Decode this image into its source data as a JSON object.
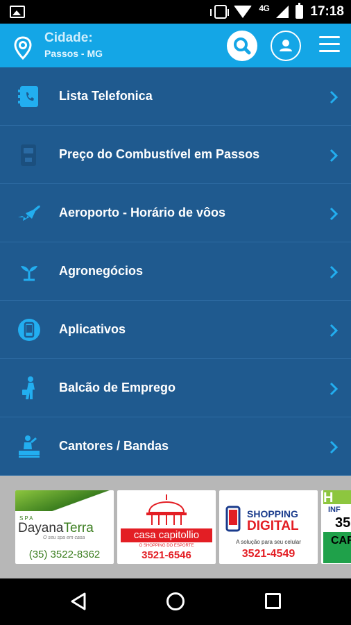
{
  "status_bar": {
    "network": "4G",
    "time": "17:18"
  },
  "header": {
    "city_label": "Cidade:",
    "city_value": "Passos - MG"
  },
  "menu": {
    "items": [
      {
        "label": "Lista Telefonica",
        "icon": "phonebook-icon"
      },
      {
        "label": "Preço do Combustível em Passos",
        "icon": "fuel-pump-icon"
      },
      {
        "label": "Aeroporto - Horário de vôos",
        "icon": "airplane-icon"
      },
      {
        "label": "Agronegócios",
        "icon": "sprout-icon"
      },
      {
        "label": "Aplicativos",
        "icon": "mobile-app-icon"
      },
      {
        "label": "Balcão de Emprego",
        "icon": "job-seeker-icon"
      },
      {
        "label": "Cantores / Bandas",
        "icon": "singer-stage-icon"
      }
    ]
  },
  "ads": [
    {
      "tagline_top": "SPA",
      "name_a": "Dayana",
      "name_b": "Terra",
      "slogan": "O seu spa em casa",
      "phone": "(35) 3522-8362"
    },
    {
      "name": "casa capitollio",
      "sub": "O SHOPPING DO ESPORTE",
      "phone": "3521-6546"
    },
    {
      "name_a": "SHOPPING",
      "name_b": "DIGITAL",
      "sub": "A solução para seu celular",
      "phone": "3521-4549"
    },
    {
      "lines": [
        "H",
        "INF",
        "35",
        "CAR"
      ]
    }
  ],
  "colors": {
    "appbar": "#14a6e6",
    "menu_bg": "#1f5a8f",
    "icon_accent": "#22aef0"
  }
}
